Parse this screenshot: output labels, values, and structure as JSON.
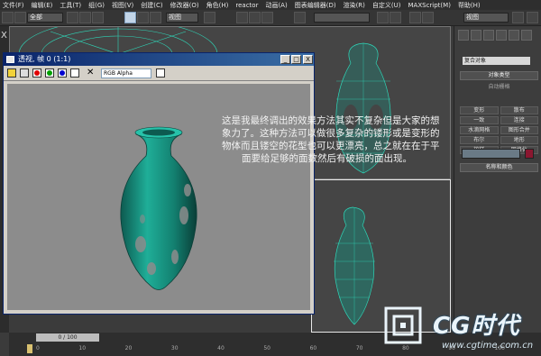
{
  "menubar": {
    "items": [
      "文件(F)",
      "编辑(E)",
      "工具(T)",
      "组(G)",
      "视图(V)",
      "创建(C)",
      "修改器(O)",
      "角色(H)",
      "reactor",
      "动画(A)",
      "图表编辑器(D)",
      "渲染(R)",
      "自定义(U)",
      "MAXScript(M)",
      "帮助(H)"
    ]
  },
  "toolbar": {
    "selection_filter": "全部",
    "view_label": "视图"
  },
  "left_strip": {
    "close_glyph": "X"
  },
  "render_window": {
    "title": "透视, 帧 0 (1:1)",
    "minimize": "_",
    "maximize": "□",
    "close": "X",
    "channel_select": "RGB Alpha",
    "channel_colors": [
      "#e00000",
      "#00a000",
      "#0000d0"
    ]
  },
  "caption": {
    "lines": [
      "这是我最终调出的效果方法其实不复杂但是大家的想",
      "象力了。这种方法可以做很多复杂的镂形或是变形的",
      "物体而且镂空的花型也可以更漂亮，总之就在在于平",
      "面要给足够的面数然后有破损的面出现。"
    ]
  },
  "command_panel": {
    "dropdown": "复合对象",
    "object_type_label": "对象类型",
    "auto_grid": "自动栅格",
    "buttons": [
      "变形",
      "散布",
      "一致",
      "连接",
      "水滴网格",
      "图形合并",
      "布尔",
      "地形",
      "放样",
      "网格化"
    ],
    "name_color_label": "名称和颜色"
  },
  "timeline": {
    "frame_counter": "0 / 100",
    "ticks": [
      "0",
      "10",
      "20",
      "30",
      "40",
      "50",
      "60",
      "70",
      "80",
      "90",
      "100"
    ]
  },
  "watermark": {
    "title": "CG时代",
    "url": "www.cgtime.com.cn"
  },
  "colors": {
    "vase": "#1a8a7a",
    "wire": "#2fd6b8",
    "render_bg": "#8c8c8c"
  }
}
